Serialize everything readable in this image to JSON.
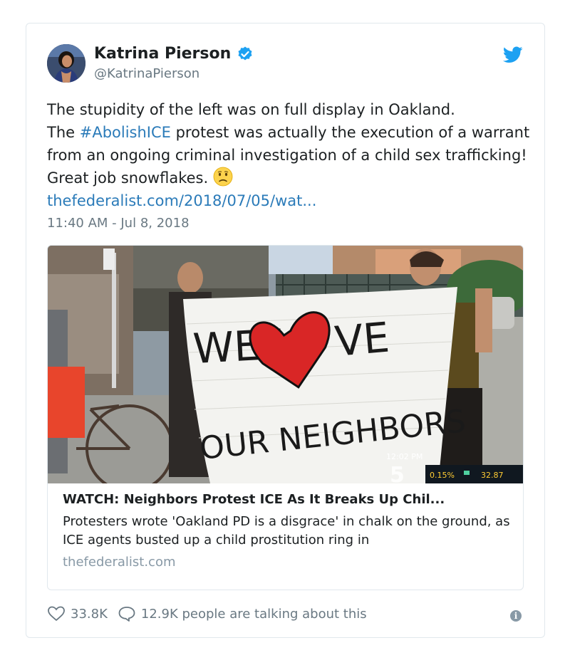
{
  "tweet": {
    "author_name": "Katrina Pierson",
    "handle": "@KatrinaPierson",
    "text_line1": "The stupidity of the left was on full display in Oakland.",
    "text_pre_hashtag": "The ",
    "hashtag": "#AbolishICE",
    "text_post_hashtag": " protest was actually the execution of a warrant from an ongoing criminal investigation of a child sex trafficking! Great job snowflakes.",
    "emoji": "frowning-face-emoji",
    "link": "thefederalist.com/2018/07/05/wat...",
    "timestamp": "11:40 AM - Jul 8, 2018"
  },
  "card": {
    "banner_text_top": "WE LOVE",
    "banner_text_bottom": "OUR NEIGHBORS",
    "tv_time": "12:02 PM",
    "tv_channel": "5",
    "ticker_pct": "0.15%",
    "ticker_value": "32.87",
    "title": "WATCH: Neighbors Protest ICE As It Breaks Up Chil...",
    "description": "Protesters wrote 'Oakland PD is a disgrace' in chalk on the ground, as ICE agents busted up a child prostitution ring in",
    "domain": "thefederalist.com"
  },
  "footer": {
    "likes": "33.8K",
    "conversation": "12.9K people are talking about this",
    "info_symbol": "i"
  },
  "colors": {
    "link_blue": "#2b7bb9",
    "verified_blue": "#1da1f2",
    "muted_gray": "#697882",
    "border": "#e1e8ed"
  },
  "icons": [
    "verified-badge-icon",
    "twitter-bird-icon",
    "heart-icon",
    "speech-bubble-icon",
    "info-icon"
  ]
}
